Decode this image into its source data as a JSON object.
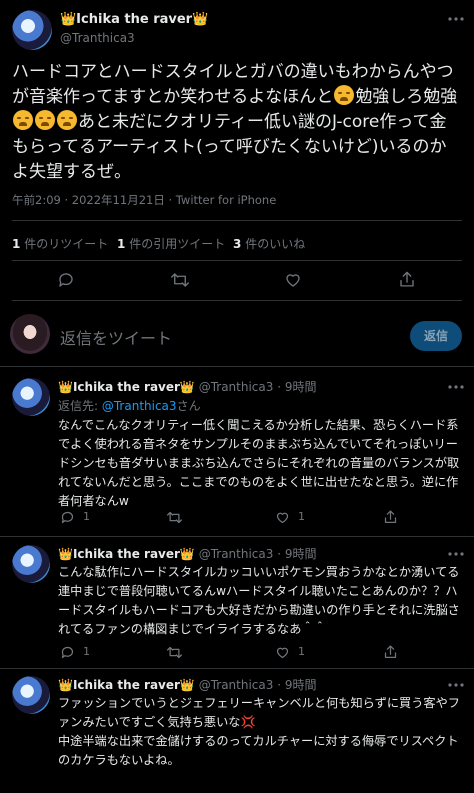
{
  "main_tweet": {
    "display_name": "👑Ichika the raver👑",
    "handle": "@Tranthica3",
    "text_part1": "ハードコアとハードスタイルとガバの違いもわからんやつが音楽作ってますとか笑わせるよなほんと",
    "text_part2": "勉強しろ勉強",
    "text_part3": "あと未だにクオリティー低い謎のJ-core作って金もらってるアーティスト(って呼びたくないけど)いるのかよ失望するぜ。",
    "timestamp": "午前2:09 · 2022年11月21日 · Twitter for iPhone"
  },
  "stats": {
    "retweets_count": "1",
    "retweets_label": "件のリツイート",
    "quotes_count": "1",
    "quotes_label": "件の引用ツイート",
    "likes_count": "3",
    "likes_label": "件のいいね"
  },
  "reply_box": {
    "placeholder": "返信をツイート",
    "button_label": "返信"
  },
  "replies": [
    {
      "display_name": "👑Ichika the raver👑",
      "handle": "@Tranthica3",
      "time": "· 9時間",
      "replying_to_prefix": "返信先: ",
      "replying_to_handle": "@Tranthica3",
      "replying_to_suffix": "さん",
      "text": "なんでこんなクオリティー低く聞こえるか分析した結果、恐らくハード系でよく使われる音ネタをサンプルそのままぶち込んでいてそれっぽいリードシンセも音ダサいままぶち込んでさらにそれぞれの音量のバランスが取れてないんだと思う。ここまでのものをよく世に出せたなと思う。逆に作者何者なんw",
      "reply_count": "1",
      "retweet_count": "",
      "like_count": "1"
    },
    {
      "display_name": "👑Ichika the raver👑",
      "handle": "@Tranthica3",
      "time": "· 9時間",
      "text": "こんな駄作にハードスタイルカッコいいポケモン買おうかなとか湧いてる連中まじで普段何聴いてるんwハードスタイル聴いたことあんのか？？ハードスタイルもハードコアも大好きだから勘違いの作り手とそれに洗脳されてるファンの構図まじでイライラするなあ＾＾",
      "reply_count": "1",
      "retweet_count": "",
      "like_count": "1"
    },
    {
      "display_name": "👑Ichika the raver👑",
      "handle": "@Tranthica3",
      "time": "· 9時間",
      "text_line1": "ファッションでいうとジェフェリーキャンベルと何も知らずに買う客やファンみたいですごく気持ち悪いな💢",
      "text_line2": "中途半端な出来で金儲けするのってカルチャーに対する侮辱でリスペクトのカケラもないよね。"
    }
  ],
  "colors": {
    "background": "#000000",
    "text": "#e7e9ea",
    "muted": "#71767b",
    "accent": "#1d9bf0",
    "divider": "#2f3336"
  }
}
